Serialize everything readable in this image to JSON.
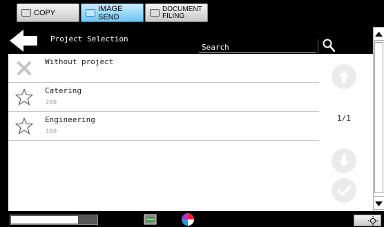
{
  "tabs": [
    {
      "label": "COPY",
      "active": false
    },
    {
      "label": "IMAGE SEND",
      "active": true
    },
    {
      "label": "DOCUMENT FILING",
      "active": false
    }
  ],
  "header": {
    "title": "Project Selection",
    "search_label": "Search"
  },
  "projects": [
    {
      "name": "Without project",
      "code": "",
      "icon": "x-icon"
    },
    {
      "name": "Catering",
      "code": "200",
      "icon": "star-outline-icon"
    },
    {
      "name": "Engineering",
      "code": "100",
      "icon": "star-outline-icon"
    }
  ],
  "pagination": {
    "page_label": "1/1"
  },
  "bottom": {
    "progress_fraction": 0.78
  },
  "colors": {
    "active_tab": "#6ec6f0",
    "background": "#000000",
    "list_bg": "#ffffff"
  }
}
